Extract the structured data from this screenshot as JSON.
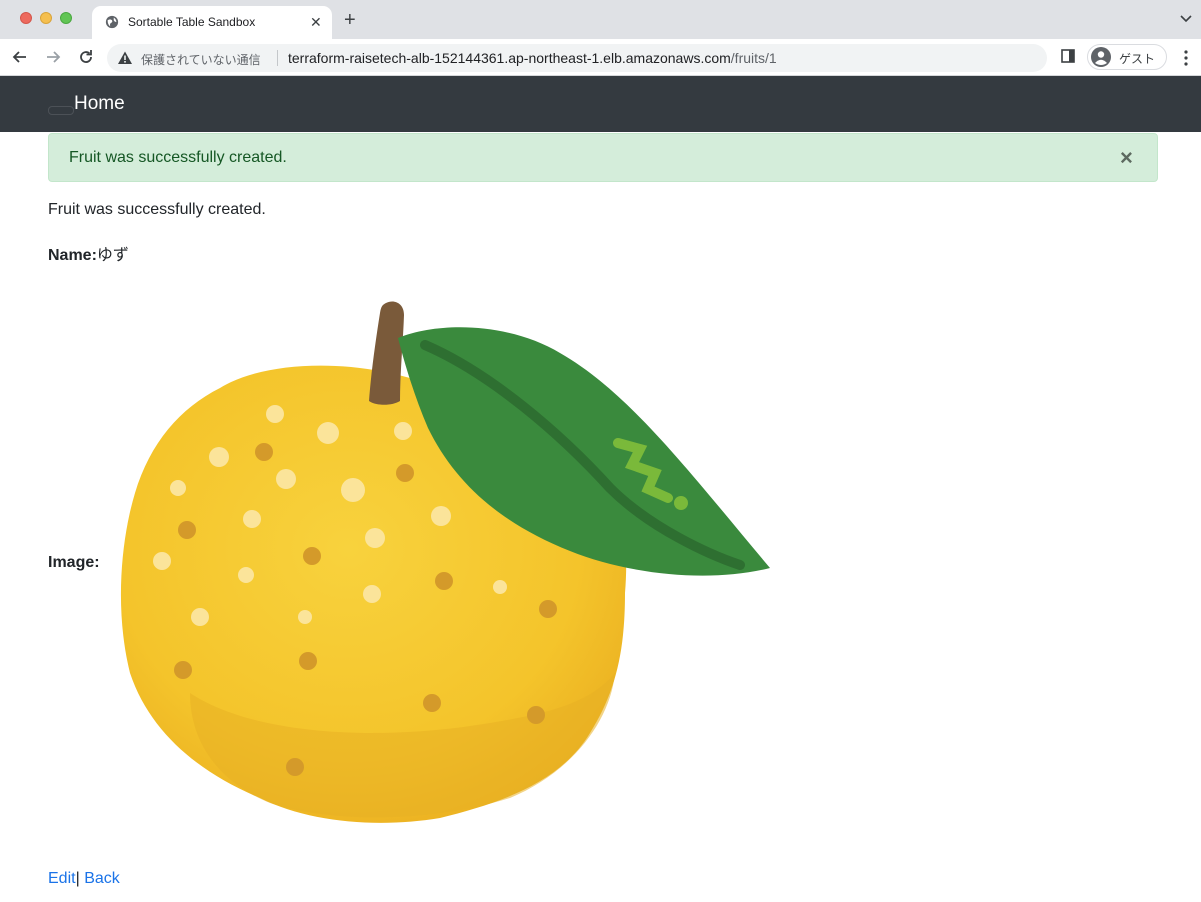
{
  "browser": {
    "tab_title": "Sortable Table Sandbox",
    "security_text": "保護されていない通信",
    "url_host": "terraform-raisetech-alb-152144361.ap-northeast-1.elb.amazonaws.com",
    "url_path": "/fruits/1",
    "profile_label": "ゲスト",
    "icons": [
      "globe-icon",
      "close-icon",
      "plus-icon",
      "chevron-down-icon",
      "back-arrow-icon",
      "forward-arrow-icon",
      "reload-icon",
      "warning-icon",
      "side-panel-icon",
      "profile-avatar-icon",
      "more-vertical-icon"
    ]
  },
  "navbar": {
    "brand": "Home",
    "background": "#343a40"
  },
  "alert": {
    "message": "Fruit was successfully created.",
    "close_glyph": "×",
    "background": "#d4edda",
    "text_color": "#155724"
  },
  "notice": "Fruit was successfully created.",
  "fruit": {
    "name_label": "Name:",
    "name_value": "ゆず",
    "image_label": "Image:"
  },
  "links": {
    "edit": "Edit",
    "separator": "|",
    "back": "Back",
    "color": "#1a73e8"
  }
}
